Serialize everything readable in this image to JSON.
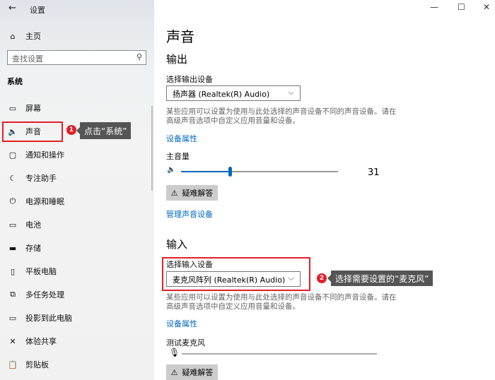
{
  "titlebar": {
    "title": "设置",
    "back": "←",
    "minimize": "—",
    "maximize": "☐",
    "close": "✕"
  },
  "sidebar": {
    "home": "主页",
    "search_placeholder": "查找设置",
    "section": "系统",
    "items": [
      {
        "icon": "display-icon",
        "glyph": "▭",
        "label": "屏幕"
      },
      {
        "icon": "speaker-icon",
        "glyph": "🔈",
        "label": "声音"
      },
      {
        "icon": "notification-icon",
        "glyph": "▢",
        "label": "通知和操作"
      },
      {
        "icon": "moon-icon",
        "glyph": "☾",
        "label": "专注助手"
      },
      {
        "icon": "power-icon",
        "glyph": "⏻",
        "label": "电源和睡眠"
      },
      {
        "icon": "battery-icon",
        "glyph": "▭",
        "label": "电池"
      },
      {
        "icon": "storage-icon",
        "glyph": "▬",
        "label": "存储"
      },
      {
        "icon": "tablet-icon",
        "glyph": "▯",
        "label": "平板电脑"
      },
      {
        "icon": "multitask-icon",
        "glyph": "⧉",
        "label": "多任务处理"
      },
      {
        "icon": "project-icon",
        "glyph": "▭",
        "label": "投影到此电脑"
      },
      {
        "icon": "share-icon",
        "glyph": "✕",
        "label": "体验共享"
      },
      {
        "icon": "clipboard-icon",
        "glyph": "📋",
        "label": "剪贴板"
      }
    ]
  },
  "annotations": {
    "step1": "1",
    "tip1": "点击“系统”",
    "step2": "2",
    "tip2": "选择需要设置的“麦克风”",
    "accent": "#e0202a"
  },
  "main": {
    "title": "声音",
    "output": {
      "heading": "输出",
      "select_label": "选择输出设备",
      "device": "扬声器 (Realtek(R) Audio)",
      "desc": "某些应用可以设置为使用与此处选择的声音设备不同的声音设备。请在高级声音选项中自定义应用音量和设备。",
      "properties": "设备属性",
      "volume_label": "主音量",
      "volume": "31",
      "volume_fraction": 0.31,
      "troubleshoot": "疑难解答",
      "manage": "管理声音设备"
    },
    "input": {
      "heading": "输入",
      "select_label": "选择输入设备",
      "device": "麦克风阵列 (Realtek(R) Audio)",
      "desc": "某些应用可以设置为使用与此处选择的声音设备不同的声音设备。请在高级声音选项中自定义应用音量和设备。",
      "properties": "设备属性",
      "test_label": "测试麦克风",
      "troubleshoot": "疑难解答"
    }
  }
}
